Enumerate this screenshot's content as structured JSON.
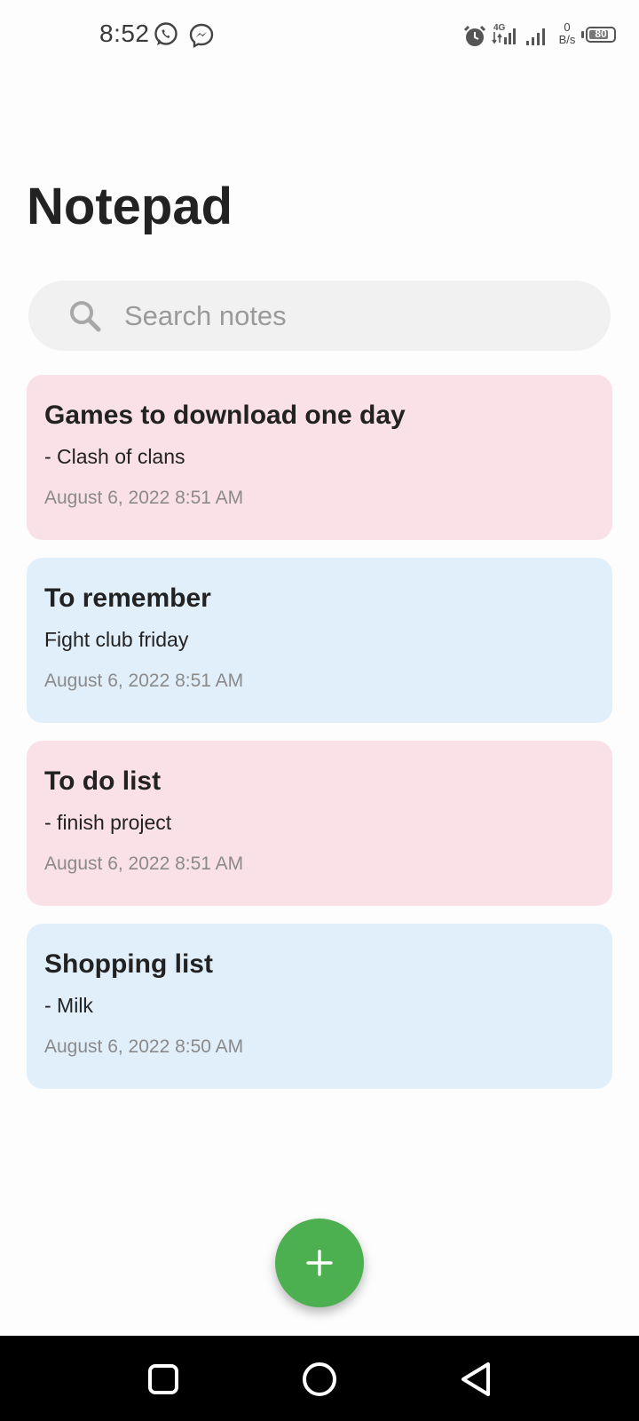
{
  "status_bar": {
    "time": "8:52",
    "icons": [
      "whatsapp-icon",
      "messenger-icon",
      "alarm-icon",
      "signal-4g-icon",
      "signal-icon"
    ],
    "net_speed_value": "0",
    "net_speed_unit": "B/s",
    "battery": "80",
    "battery_level": 80
  },
  "header": {
    "title": "Notepad"
  },
  "search": {
    "placeholder": "Search notes",
    "value": ""
  },
  "notes": [
    {
      "title": "Games to download one day",
      "body": "- Clash of clans",
      "date": "August 6, 2022 8:51 AM",
      "color": "#fae1e8"
    },
    {
      "title": "To remember",
      "body": "Fight club friday",
      "date": "August 6, 2022 8:51 AM",
      "color": "#e1effb"
    },
    {
      "title": "To do list",
      "body": "- finish project",
      "date": "August 6, 2022 8:51 AM",
      "color": "#fae1e8"
    },
    {
      "title": "Shopping list",
      "body": "- Milk",
      "date": "August 6, 2022 8:50 AM",
      "color": "#e1effb"
    }
  ],
  "fab": {
    "icon": "plus-icon",
    "color": "#4caf50"
  },
  "nav": {
    "buttons": [
      "recents-square-icon",
      "home-circle-icon",
      "back-triangle-icon"
    ]
  }
}
